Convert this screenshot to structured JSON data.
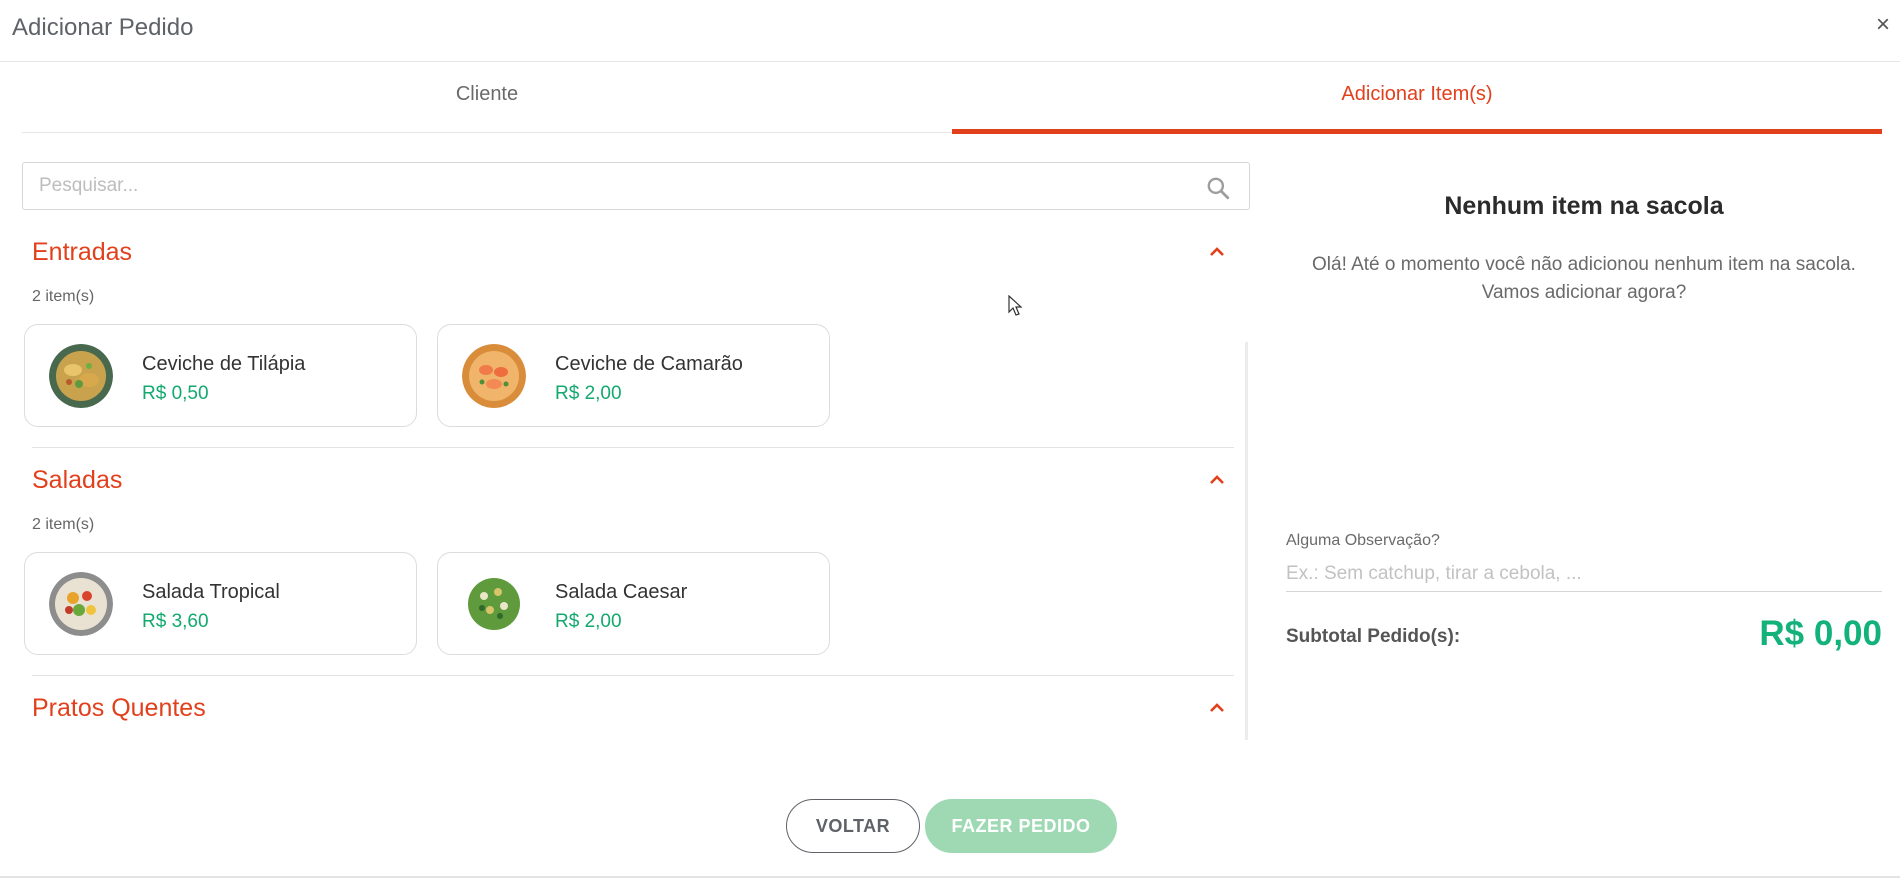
{
  "modal": {
    "title": "Adicionar Pedido",
    "close_glyph": "×"
  },
  "tabs": [
    {
      "label": "Cliente",
      "active": false
    },
    {
      "label": "Adicionar Item(s)",
      "active": true
    }
  ],
  "search": {
    "placeholder": "Pesquisar...",
    "icon": "search-icon"
  },
  "categories": [
    {
      "title": "Entradas",
      "count": "2 item(s)",
      "items": [
        {
          "name": "Ceviche de Tilápia",
          "price": "R$ 0,50"
        },
        {
          "name": "Ceviche de Camarão",
          "price": "R$ 2,00"
        }
      ]
    },
    {
      "title": "Saladas",
      "count": "2 item(s)",
      "items": [
        {
          "name": "Salada Tropical",
          "price": "R$ 3,60"
        },
        {
          "name": "Salada Caesar",
          "price": "R$ 2,00"
        }
      ]
    },
    {
      "title": "Pratos Quentes"
    }
  ],
  "bag": {
    "empty_title": "Nenhum item na sacola",
    "empty_message_line1": "Olá! Até o momento você não adicionou nenhum item na sacola.",
    "empty_message_line2": "Vamos adicionar agora?"
  },
  "observation": {
    "label": "Alguma Observação?",
    "placeholder": "Ex.: Sem catchup, tirar a cebola, ..."
  },
  "subtotal": {
    "label": "Subtotal Pedido(s):",
    "value": "R$ 0,00"
  },
  "buttons": {
    "back": "VOLTAR",
    "order": "FAZER PEDIDO"
  },
  "colors": {
    "accent": "#e2401c",
    "price_green": "#12a96f",
    "order_button_disabled": "#9fd9b4"
  }
}
